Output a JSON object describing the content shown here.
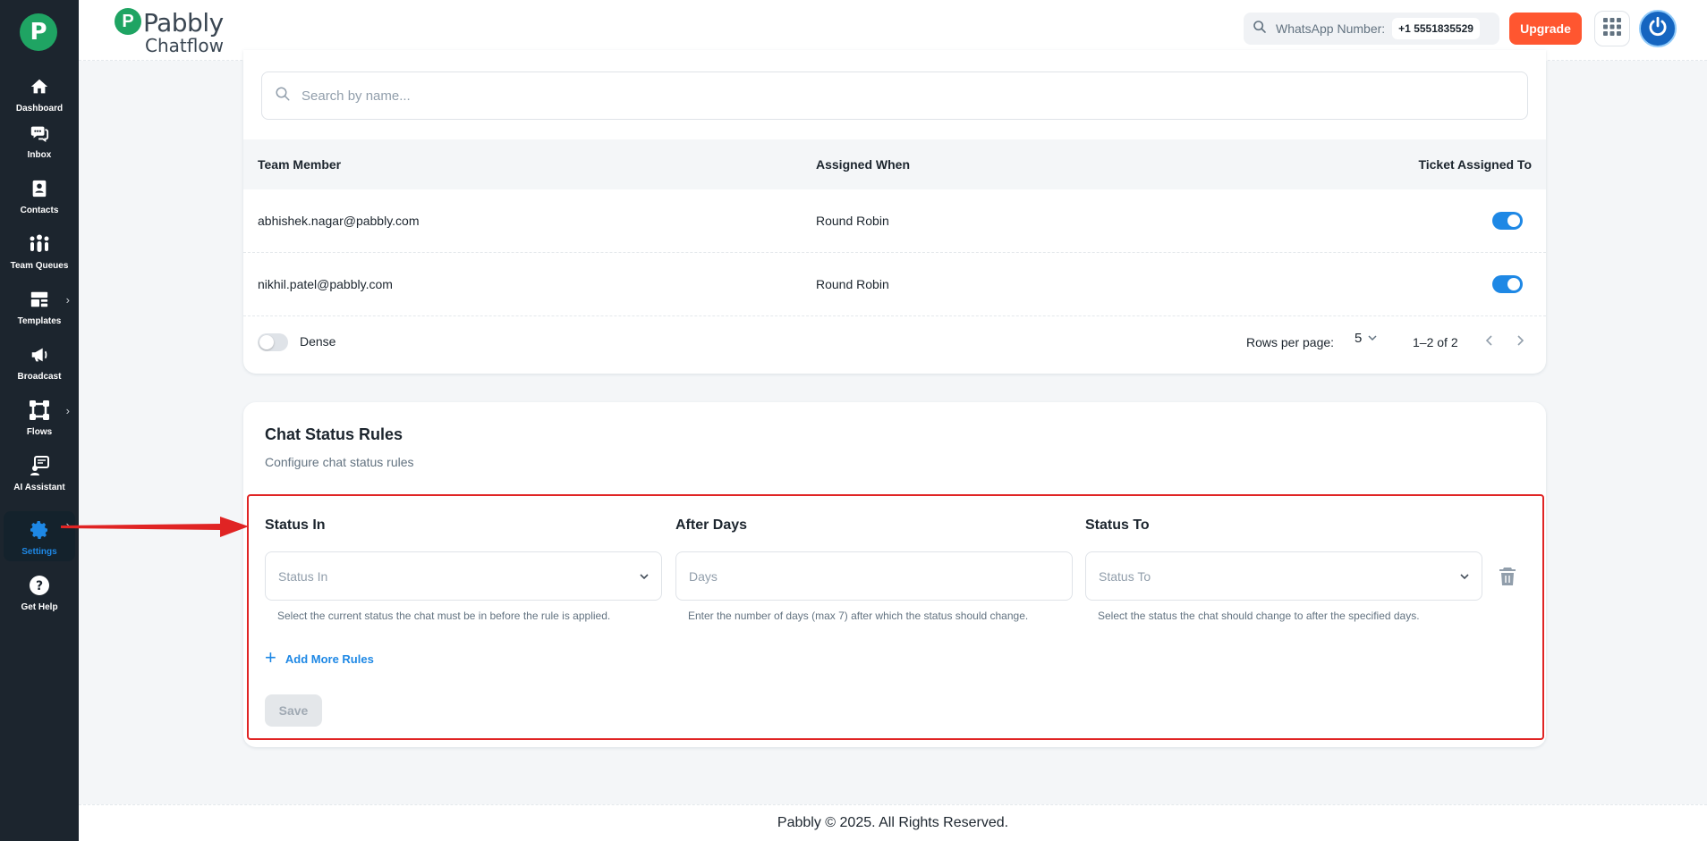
{
  "sidebar": {
    "items": [
      {
        "label": "Dashboard",
        "icon": "home-icon"
      },
      {
        "label": "Inbox",
        "icon": "chat-bubbles-icon"
      },
      {
        "label": "Contacts",
        "icon": "contact-book-icon"
      },
      {
        "label": "Team Queues",
        "icon": "team-icon"
      },
      {
        "label": "Templates",
        "icon": "template-icon"
      },
      {
        "label": "Broadcast",
        "icon": "megaphone-icon"
      },
      {
        "label": "Flows",
        "icon": "flows-icon"
      },
      {
        "label": "AI Assistant",
        "icon": "ai-assistant-icon"
      },
      {
        "label": "Settings",
        "icon": "gear-icon",
        "active": true
      },
      {
        "label": "Get Help",
        "icon": "help-icon"
      }
    ]
  },
  "header": {
    "brand_line1": "Pabbly",
    "brand_line2": "Chatflow",
    "whatsapp_label": "WhatsApp Number:",
    "whatsapp_number": "+1 5551835529",
    "upgrade_label": "Upgrade"
  },
  "team_table": {
    "search_placeholder": "Search by name...",
    "columns": [
      "Team Member",
      "Assigned When",
      "Ticket Assigned To"
    ],
    "rows": [
      {
        "member": "abhishek.nagar@pabbly.com",
        "assigned_when": "Round Robin",
        "ticket_assigned": true
      },
      {
        "member": "nikhil.patel@pabbly.com",
        "assigned_when": "Round Robin",
        "ticket_assigned": true
      }
    ],
    "dense_label": "Dense",
    "dense_on": false,
    "rows_per_page_label": "Rows per page:",
    "rows_per_page_value": "5",
    "range_text": "1–2 of 2"
  },
  "chat_status_rules": {
    "title": "Chat Status Rules",
    "subtitle": "Configure chat status rules",
    "status_in_label": "Status In",
    "status_in_placeholder": "Status In",
    "status_in_help": "Select the current status the chat must be in before the rule is applied.",
    "after_days_label": "After Days",
    "after_days_placeholder": "Days",
    "after_days_help": "Enter the number of days (max 7) after which the status should change.",
    "status_to_label": "Status To",
    "status_to_placeholder": "Status To",
    "status_to_help": "Select the status the chat should change to after the specified days.",
    "add_more_label": "Add More Rules",
    "save_label": "Save"
  },
  "footer": {
    "text": "Pabbly © 2025. All Rights Reserved."
  },
  "colors": {
    "sidebar_bg": "#1c252e",
    "accent_blue": "#1e88e5",
    "upgrade": "#ff5630",
    "annotation_red": "#e02424",
    "brand_green": "#1fa463"
  }
}
